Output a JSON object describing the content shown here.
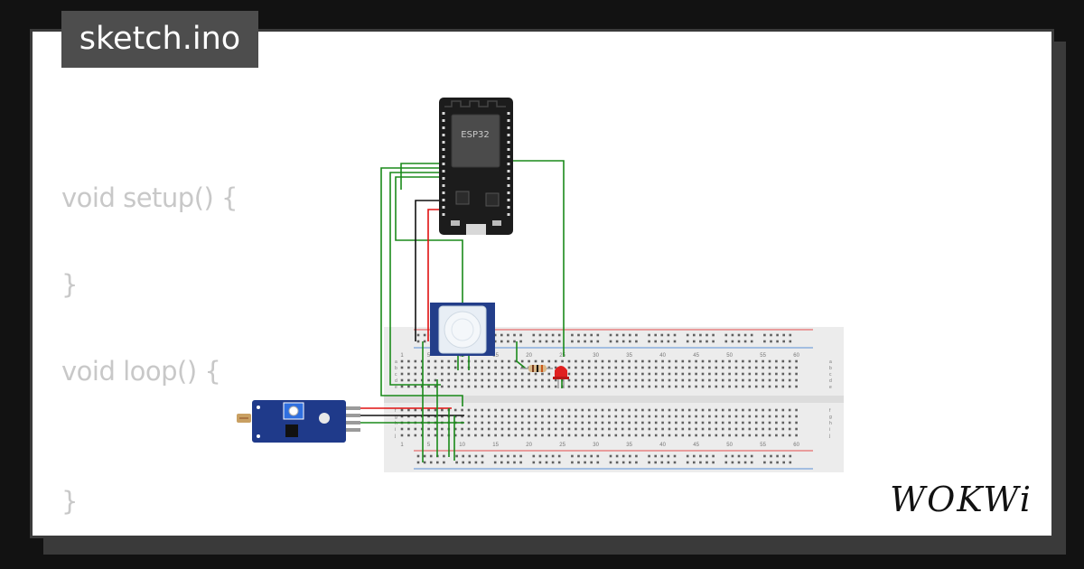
{
  "file_tab": {
    "label": "sketch.ino"
  },
  "code": {
    "lines": [
      "void setup() {",
      "}",
      "void loop() {",
      "}"
    ]
  },
  "circuit": {
    "board": {
      "label": "ESP32"
    },
    "breadboard_numbers": [
      "1",
      "5",
      "10",
      "15",
      "20",
      "25",
      "30",
      "35",
      "40",
      "45",
      "50",
      "55",
      "60"
    ],
    "breadboard_rows_top": [
      "a",
      "b",
      "c",
      "d",
      "e"
    ],
    "breadboard_rows_bottom": [
      "f",
      "g",
      "h",
      "i",
      "j"
    ],
    "components": [
      "esp32-board",
      "pir-motion-sensor",
      "ldr-sensor-module",
      "resistor",
      "red-led"
    ]
  },
  "brand": {
    "name": "WOKWi"
  },
  "colors": {
    "background": "#121212",
    "card": "#ffffff",
    "tab": "#4d4d4d",
    "code_text": "#c8c8c8",
    "wire_green": "#1a8a1a",
    "wire_red": "#e01010",
    "wire_black": "#111111"
  }
}
